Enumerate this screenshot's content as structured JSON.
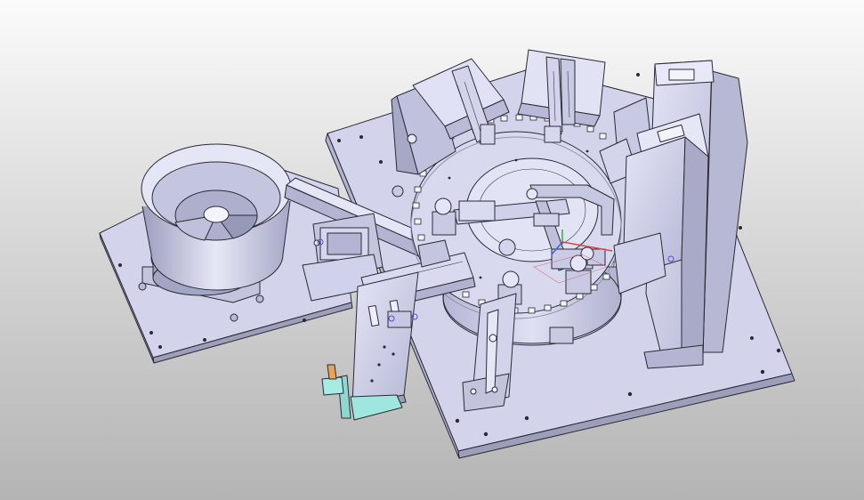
{
  "viewport": {
    "background_top": "#fbfbfb",
    "background_bottom": "#b4b4b4"
  },
  "model": {
    "part_fill": "#d7d8ef",
    "part_shade": "#b9bbd8",
    "edge_color": "#2a2a36",
    "base_plate_fill": "#d3d4ec",
    "highlight_part_color": "#9fe6de",
    "tab_part_color": "#e8a55a"
  },
  "triad": {
    "x_axis_color": "#e04040",
    "y_axis_color": "#30b040",
    "z_axis_color": "#4060e0"
  }
}
